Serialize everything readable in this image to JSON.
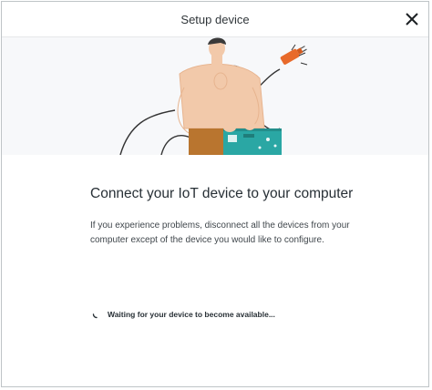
{
  "dialog": {
    "title": "Setup device",
    "close_icon": "close-icon"
  },
  "illustration": {
    "icon": "person-connecting-board-illustration"
  },
  "body": {
    "heading": "Connect your IoT device to your computer",
    "description": "If you experience problems, disconnect all the devices from your computer except of the device you would like to configure."
  },
  "status": {
    "spinner_icon": "spinner-icon",
    "text": "Waiting for your device to become available..."
  },
  "colors": {
    "teal_board": "#2aa7a4",
    "orange_plug": "#e86a2b",
    "skin": "#f2c9aa",
    "hair": "#3a3a3a",
    "pants": "#b9752f"
  }
}
